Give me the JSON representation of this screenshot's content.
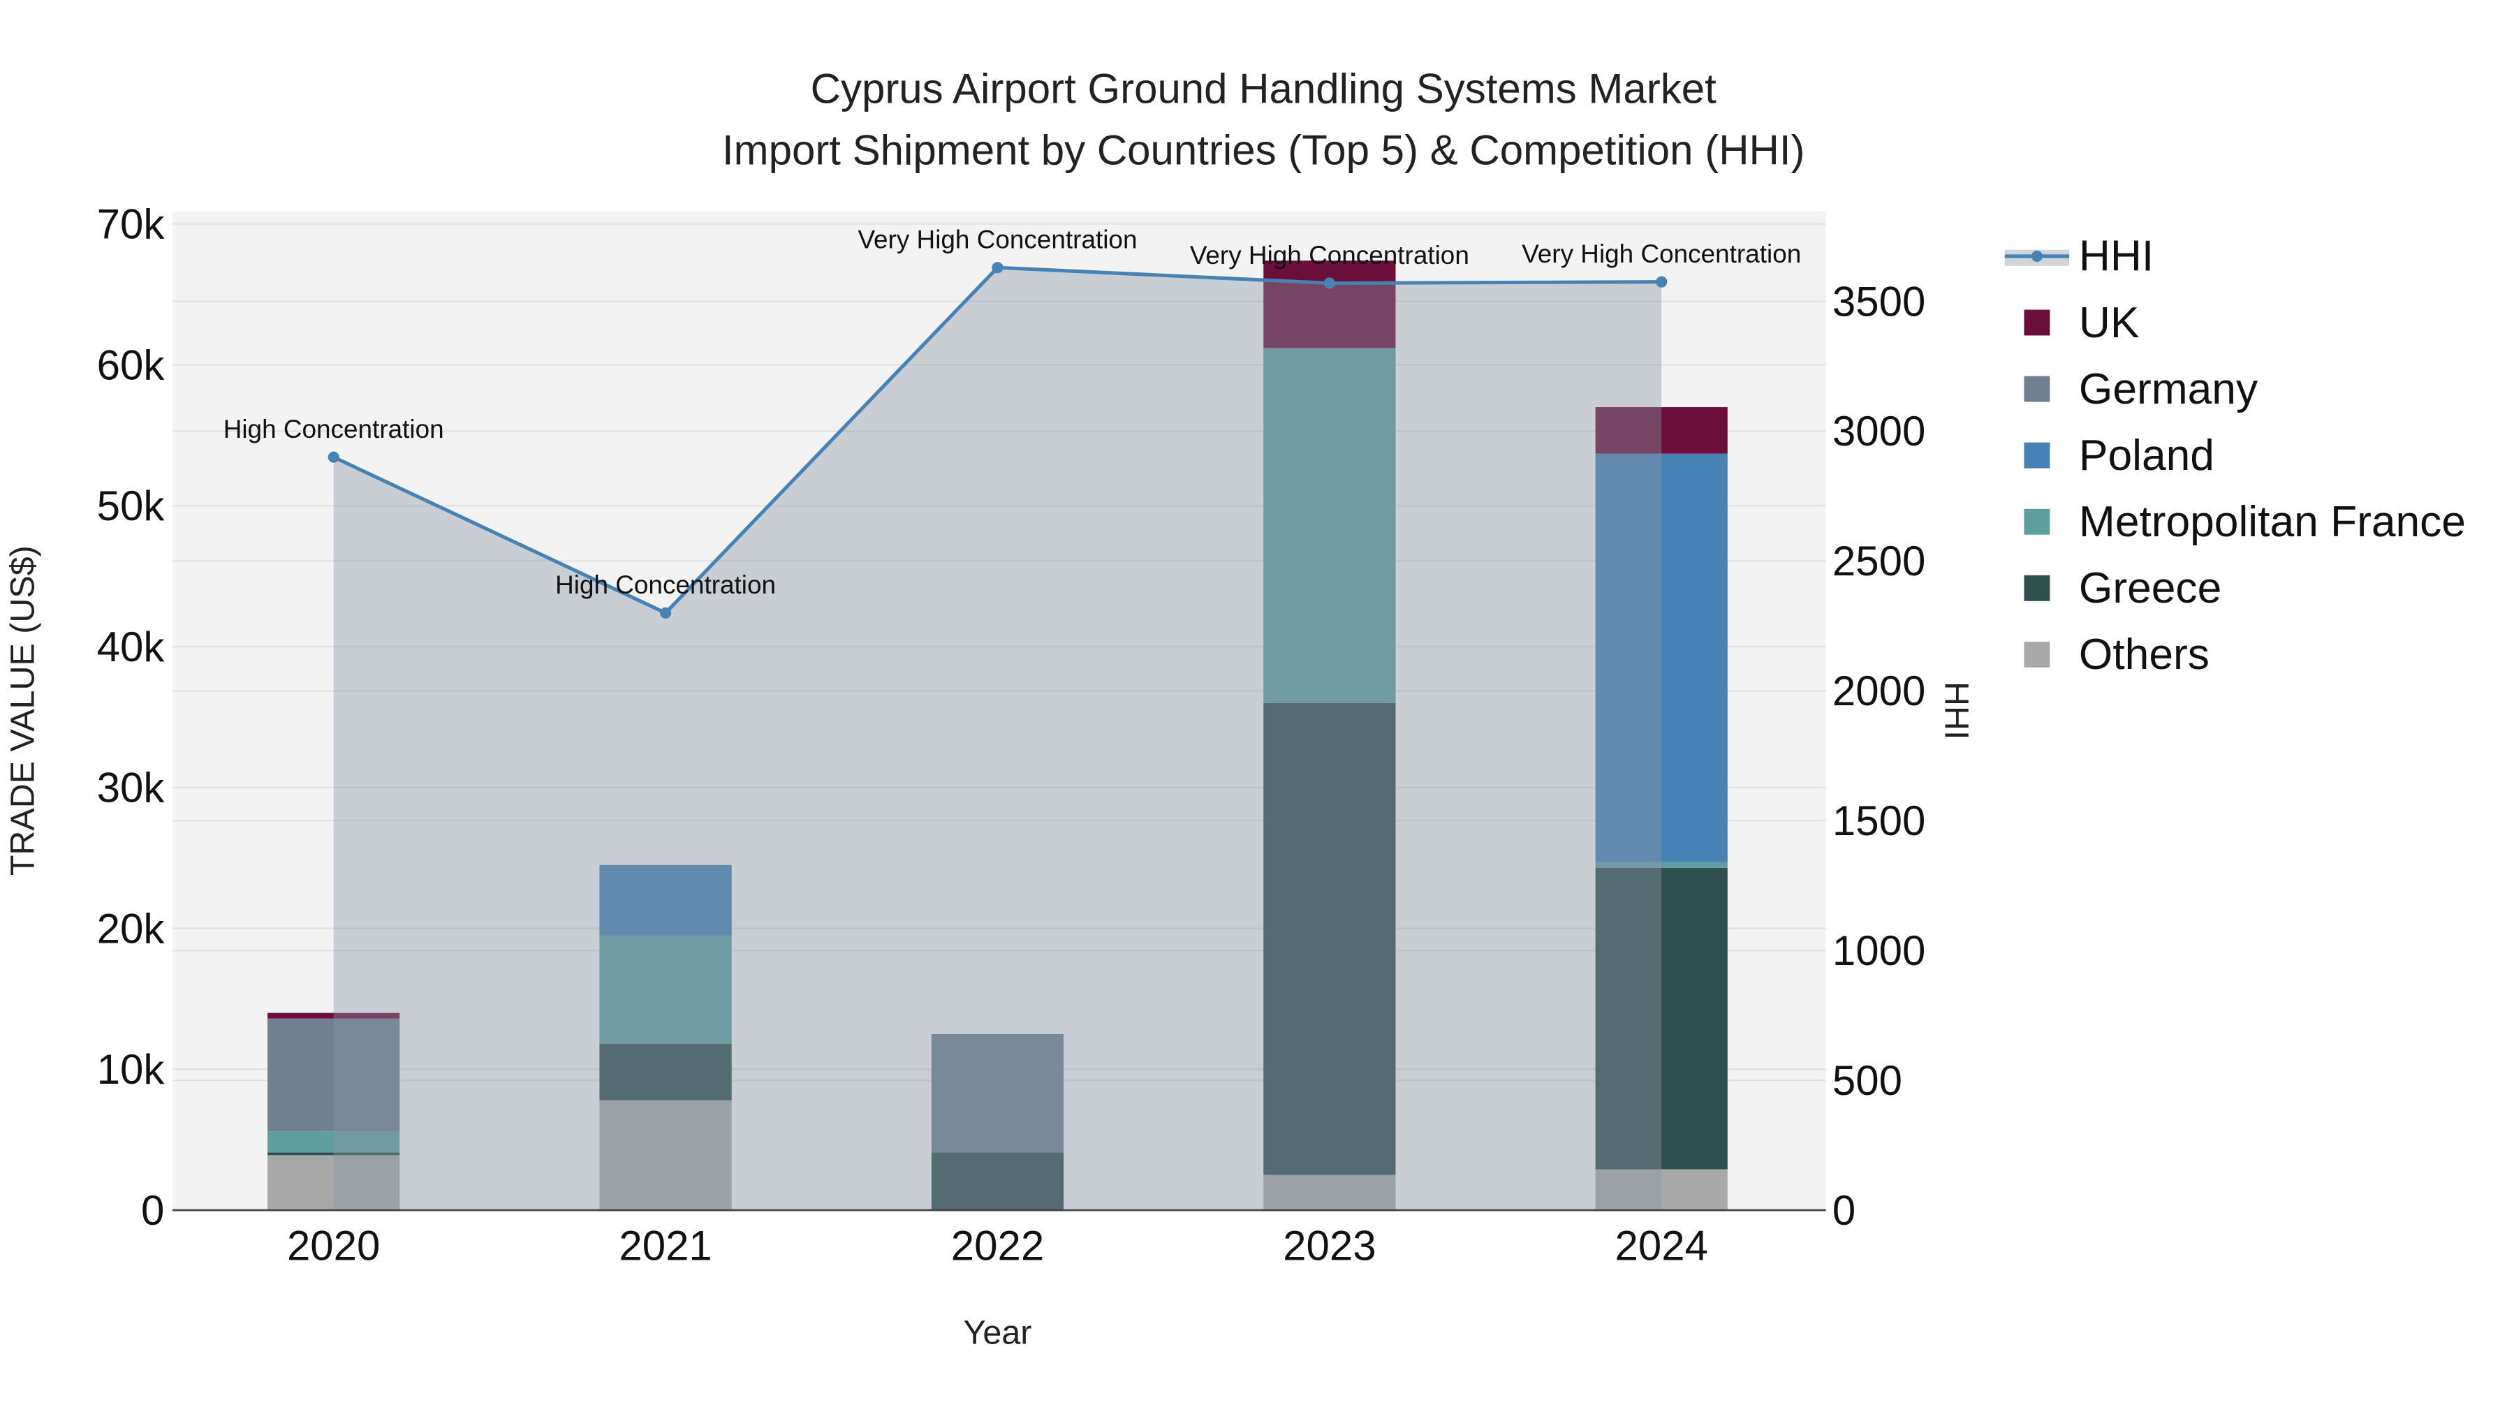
{
  "chart_data": {
    "type": "bar",
    "stacked": true,
    "title_line1": "Cyprus Airport Ground Handling Systems Market",
    "title_line2": "Import Shipment by Countries (Top 5) & Competition (HHI)",
    "xlabel": "Year",
    "ylabel": "TRADE VALUE (US$)",
    "y2label": "HHI",
    "ylim": [
      0,
      70000
    ],
    "y2lim": [
      0,
      3800
    ],
    "yticks": [
      0,
      10000,
      20000,
      30000,
      40000,
      50000,
      60000,
      70000
    ],
    "ytick_labels": [
      "0",
      "10k",
      "20k",
      "30k",
      "40k",
      "50k",
      "60k",
      "70k"
    ],
    "y2ticks": [
      0,
      500,
      1000,
      1500,
      2000,
      2500,
      3000,
      3500
    ],
    "y2tick_labels": [
      "0",
      "500",
      "1000",
      "1500",
      "2000",
      "2500",
      "3000",
      "3500"
    ],
    "categories": [
      "2020",
      "2021",
      "2022",
      "2023",
      "2024"
    ],
    "series": [
      {
        "name": "Others",
        "color": "#a9a9a9",
        "values": [
          3900,
          7800,
          0,
          2500,
          2900
        ]
      },
      {
        "name": "Greece",
        "color": "#2f4f4f",
        "values": [
          200,
          4000,
          4100,
          33500,
          21400
        ]
      },
      {
        "name": "Metropolitan France",
        "color": "#5f9ea0",
        "values": [
          1500,
          7700,
          0,
          25200,
          400
        ]
      },
      {
        "name": "Poland",
        "color": "#4682b4",
        "values": [
          0,
          5000,
          0,
          0,
          29000
        ]
      },
      {
        "name": "Germany",
        "color": "#708090",
        "values": [
          8000,
          0,
          8400,
          0,
          0
        ]
      },
      {
        "name": "UK",
        "color": "#6b0f3a",
        "values": [
          400,
          0,
          0,
          6200,
          3300
        ]
      }
    ],
    "hhi": {
      "name": "HHI",
      "color": "#4682b4",
      "values": [
        2900,
        2300,
        3630,
        3570,
        3575
      ],
      "annotations": [
        "High Concentration",
        "High Concentration",
        "Very High Concentration",
        "Very High Concentration",
        "Very High Concentration"
      ]
    },
    "legend_order": [
      "HHI",
      "UK",
      "Germany",
      "Poland",
      "Metropolitan France",
      "Greece",
      "Others"
    ],
    "legend_position": "right",
    "grid": true
  }
}
